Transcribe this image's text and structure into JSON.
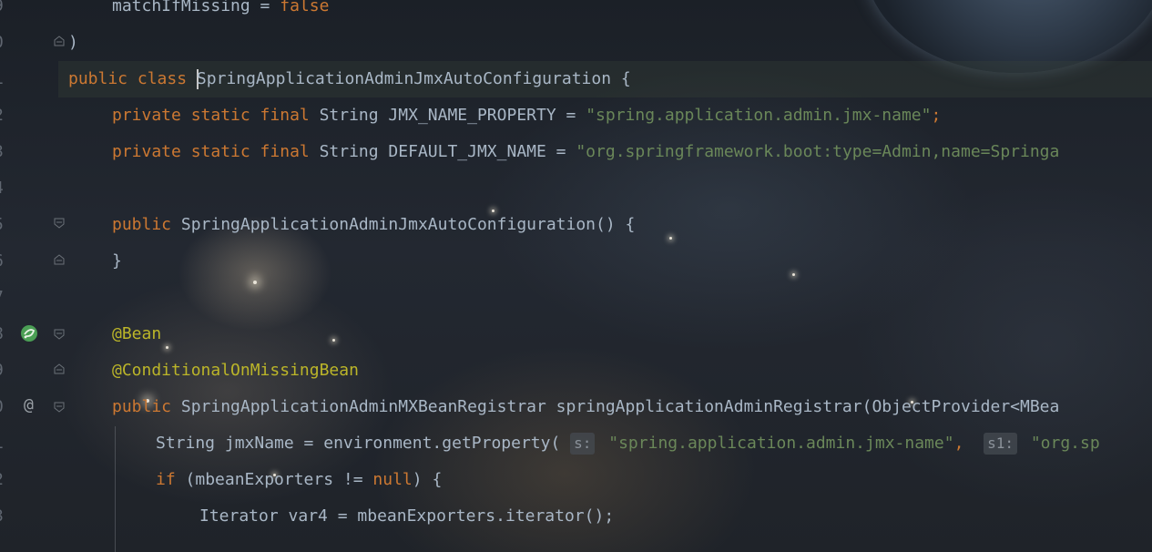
{
  "gutter": {
    "line_numbers": [
      "9",
      "0",
      "1",
      "2",
      "3",
      "4",
      "5",
      "6",
      "7",
      "8",
      "9",
      "0",
      "1",
      "2",
      "3"
    ]
  },
  "code": {
    "l09": [
      "matchIfMissing = ",
      "false"
    ],
    "l10": ")",
    "l11": [
      "public class ",
      "SpringApplicationAdminJmxAutoConfiguration",
      " {"
    ],
    "l12": [
      "private static final ",
      "String JMX_NAME_PROPERTY = ",
      "\"spring.application.admin.jmx-name\"",
      ";"
    ],
    "l13": [
      "private static final ",
      "String DEFAULT_JMX_NAME = ",
      "\"org.springframework.boot:type=Admin,name=Springa"
    ],
    "l15": [
      "public ",
      "SpringApplicationAdminJmxAutoConfiguration() {"
    ],
    "l16": "}",
    "l18": "@Bean",
    "l19": "@ConditionalOnMissingBean",
    "l20": [
      "public ",
      "SpringApplicationAdminMXBeanRegistrar springApplicationAdminRegistrar(ObjectProvider<MBea"
    ],
    "l21": [
      "String jmxName = environment.getProperty( ",
      "s:",
      " \"spring.application.admin.jmx-name\"",
      ",  ",
      "s1:",
      " \"org.sp"
    ],
    "l22": [
      "if ",
      "(mbeanExporters != ",
      "null",
      ") {"
    ],
    "l23": "Iterator var4 = mbeanExporters.iterator();"
  },
  "icons": {
    "bean_gutter": "spring-bean-icon",
    "override_gutter": "at-sign-icon"
  },
  "colors": {
    "keyword": "#cc7832",
    "string": "#6a8759",
    "annotation": "#bbb529",
    "text": "#a9b7c6"
  }
}
